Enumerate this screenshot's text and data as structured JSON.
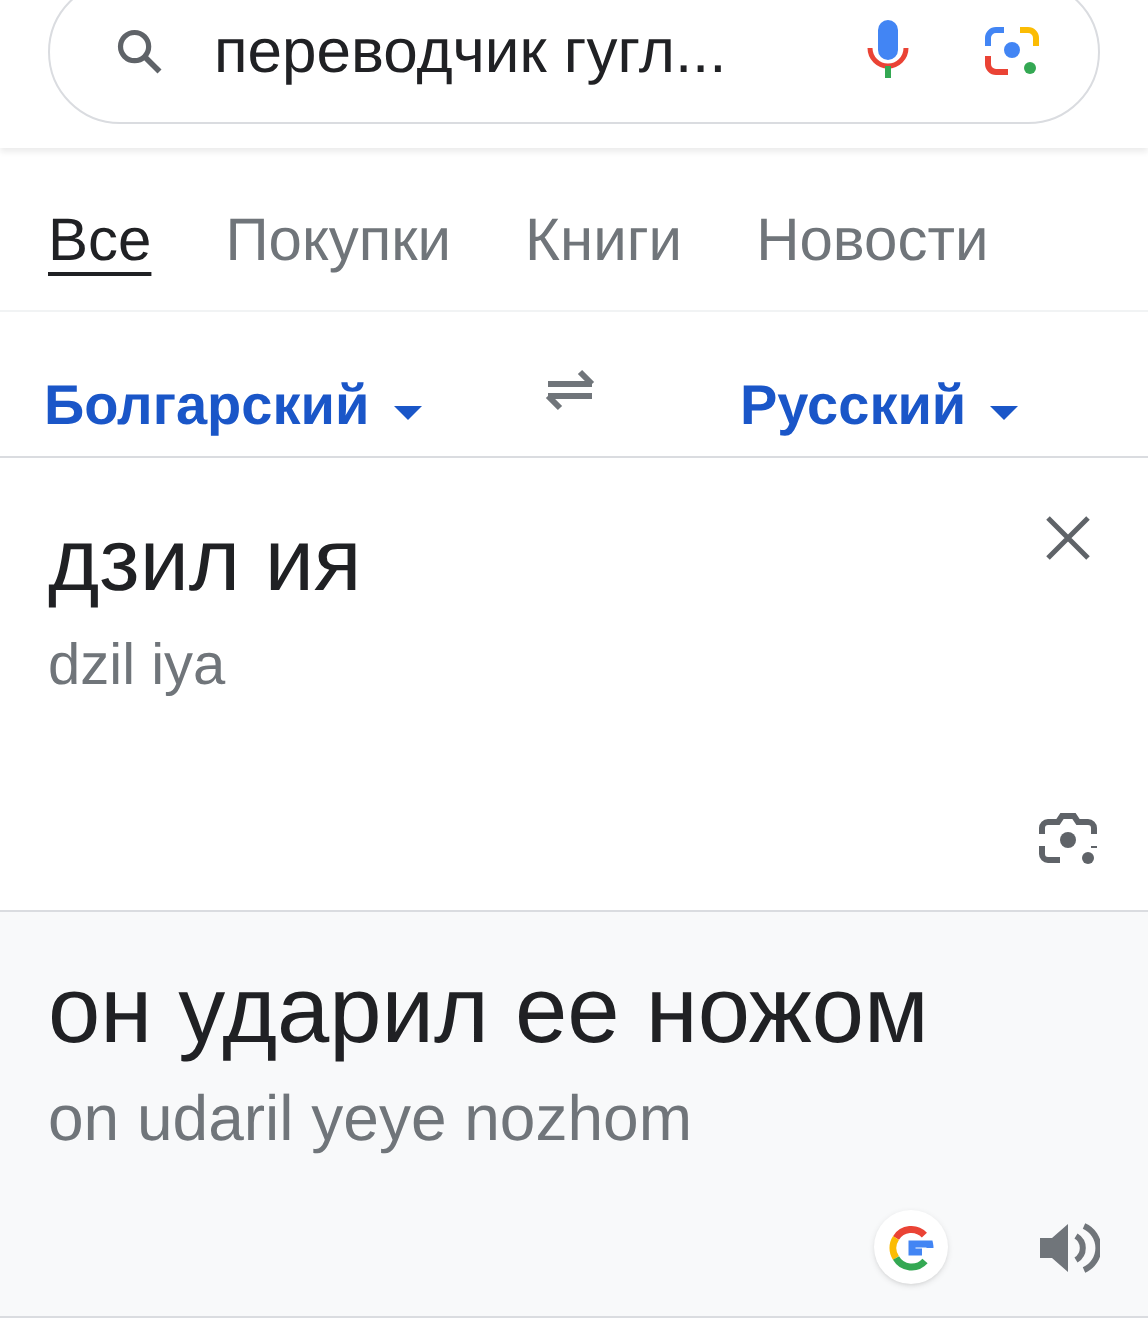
{
  "search": {
    "value": "переводчик гугл..."
  },
  "tabs": [
    {
      "label": "Все",
      "selected": true
    },
    {
      "label": "Покупки",
      "selected": false
    },
    {
      "label": "Книги",
      "selected": false
    },
    {
      "label": "Новости",
      "selected": false
    }
  ],
  "translator": {
    "source_language": "Болгарский",
    "target_language": "Русский",
    "source": {
      "text": "дзил ия",
      "transliteration": "dzil iya"
    },
    "result": {
      "text": "он ударил ее ножом",
      "transliteration": "on udaril yeye nozhom"
    }
  }
}
